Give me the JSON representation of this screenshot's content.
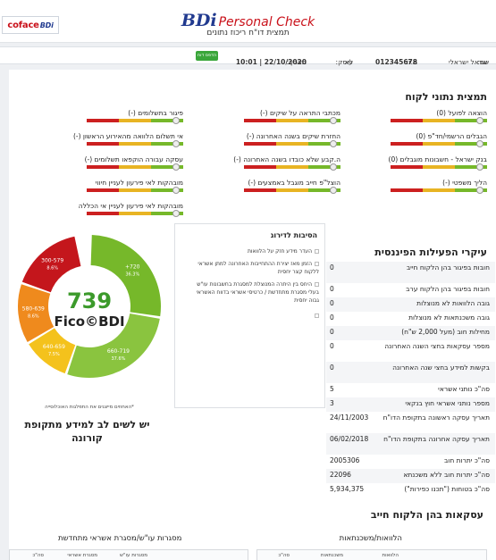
{
  "header": {
    "coface_logo": "coface",
    "coface_logo_suffix": "BDi",
    "brand_bdi": "BDi",
    "brand_pc": "Personal Check",
    "subtitle": "תמצית דו\"ח ריכוז נתונים"
  },
  "infobar": {
    "name_label": "שם:",
    "name_value": "ישראל ישראלי",
    "id_label": "ת.ז:",
    "id_value": "012345678",
    "occupation_label": "עוסק:",
    "occupation_value": "לא",
    "date_label": "תאריך:",
    "date_value": "22/10/2020 | 10:01",
    "print_button": "הדפס דוח"
  },
  "customer_data": {
    "title": "תמצית נתוני לקוח",
    "indicators": [
      {
        "label": "הוצאה לפועל (0)",
        "level": 0.93
      },
      {
        "label": "מכתבי התראה על שיקים (-)",
        "level": 0.93
      },
      {
        "label": "פיגור בתשלומים (-)",
        "level": 0.93
      },
      {
        "label": "הגבלים הרשמי/חד\"פ (0)",
        "level": 0.93
      },
      {
        "label": "החזרת שיקים בשנה האחרונה (-)",
        "level": 0.93
      },
      {
        "label": "אי תשלום הלוואה מהאירוע הראשון (-)",
        "level": 0.93
      },
      {
        "label": "בנק ישראל - חשבונות מוגבלים (0)",
        "level": 0.93
      },
      {
        "label": "ה.קבע שלא כובדו בשנה האחרונה (-)",
        "level": 0.93
      },
      {
        "label": "עסקה עבורה הוקפאו תשלומים (-)",
        "level": 0.93
      },
      {
        "label": "הליך משפטי (-)",
        "level": 0.93
      },
      {
        "label": "הוצל\"פ חייב מוגבל באמצעים (-)",
        "level": 0.93
      },
      {
        "label": "מובהקות לאי פירעון לעניין חיווי",
        "level": 0.93
      },
      {
        "label": "מובהקות לאי פירעון לעניין אי הכללה",
        "level": 0.93
      }
    ]
  },
  "reasons": {
    "title": "הסיבות לדירוג",
    "items": [
      "העדר מידע חזק על הלוואות",
      "הזמן מאז יצירת ההתחייבות האחרונה למתן אשראי ללקוח קצר יחסית",
      "היחס בין היתרה המנוצלת למסגרת בחשבונות עו\"ש בעלי מסגרת מתחדשת / כרטיסי אשראי בדווח האשראי גבוה יחסית",
      ""
    ]
  },
  "gauge": {
    "score": "739",
    "brand": "Fico",
    "brand_mark": "©",
    "brand_suffix": "BDI",
    "segments": [
      {
        "range": "300-579",
        "percent": "8.6%",
        "color": "#c4161c"
      },
      {
        "range": "580-639",
        "percent": "8.6%",
        "color": "#ef8a1d"
      },
      {
        "range": "640-659",
        "percent": "7.5%",
        "color": "#f4c21c"
      },
      {
        "range": "660-719",
        "percent": "37.6%",
        "color": "#8ac43f"
      },
      {
        "range": "720+",
        "percent": "36.3%",
        "color": "#76b82a"
      }
    ],
    "note": "*האחוזים מייצגים את התפלגות האוכלוסייה",
    "attention": "יש לשים לב למידע מתקופת קורונה"
  },
  "financial": {
    "title": "עיקרי הפעילות הפיננסית",
    "rows": [
      {
        "k": "חובות בפיגור בהן הלקוח חייב",
        "v": "0"
      },
      {
        "k": "חובות בפיגור בהן הלקוח ערב",
        "v": "0"
      },
      {
        "k": "גובה הלוואות לא מנוצלות",
        "v": "0"
      },
      {
        "k": "גובה משכנתאות לא מנוצלות",
        "v": "0"
      },
      {
        "k": "מחילות חוב (מעל 2,000 ש\"ח)",
        "v": "0"
      },
      {
        "k": "מספר עסקאות בחצי השנה האחרונה",
        "v": "0"
      },
      {
        "k": "בקשות למידע בחצי שנה האחרונה",
        "v": "0"
      },
      {
        "k": "סה\"כ נותני אשראי",
        "v": "5"
      },
      {
        "k": "מספר נותני אשראי חוץ בנקאי",
        "v": "3"
      },
      {
        "k": "תאריך עסקה ראשונה בתקופת הדו\"ח",
        "v": "24/11/2003"
      },
      {
        "k": "תאריך עסקה אחרונה בתקופת הדו\"ח",
        "v": "06/02/2018"
      },
      {
        "k": "סה\"כ יתרות חוב",
        "v": "2005306"
      },
      {
        "k": "סה\"כ יתרות חוב ללא משכנתא",
        "v": "22096"
      },
      {
        "k": "סה\"כ בטוחות (\"תכנו כפירות\")",
        "v": "5,934,375"
      }
    ]
  },
  "deals": {
    "title": "עסקאות בהן הלקוח חייב",
    "loans_title": "הלוואות/משכנתאות",
    "loans_cols": [
      "הלוואות",
      "משכנתאות",
      "סה\"כ"
    ],
    "credit_title": "מסגרות עו\"ש/מסגרת אשראי מתחדשת",
    "credit_cols": [
      "מסגרות עו\"ש",
      "מסגרת אשראי",
      "סה\"כ"
    ]
  },
  "colors": {
    "red": "#cc2020",
    "yellow": "#e8b423",
    "green": "#76b82a",
    "brand_blue": "#213a8f",
    "brand_red": "#c9111a"
  }
}
